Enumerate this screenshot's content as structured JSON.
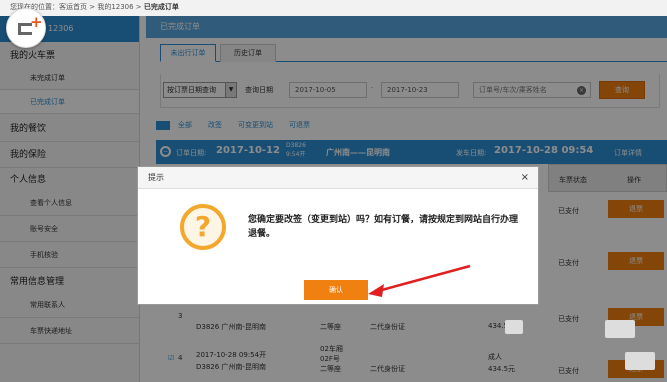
{
  "breadcrumb": {
    "prefix": "您现在的位置：客运首页 > 我的12306 >",
    "current": "已完成订单"
  },
  "sidebar": {
    "header": "12306",
    "sections": [
      {
        "title": "我的火车票",
        "items": [
          "未完成订单",
          "已完成订单"
        ]
      },
      {
        "title": "我的餐饮",
        "items": []
      },
      {
        "title": "我的保险",
        "items": []
      },
      {
        "title": "个人信息",
        "items": [
          "查看个人信息",
          "账号安全",
          "手机核验"
        ]
      },
      {
        "title": "常用信息管理",
        "items": [
          "常用联系人",
          "车票快递地址"
        ]
      }
    ]
  },
  "main": {
    "header": "已完成订单"
  },
  "tabs": [
    "未出行订单",
    "历史订单"
  ],
  "filter": {
    "select_value": "按订票日期查询",
    "date_label": "查询日期",
    "date_from": "2017-10-05",
    "date_to": "2017-10-23",
    "separator": "-",
    "keyword_placeholder": "订单号/车次/乘客姓名",
    "query_button": "查询"
  },
  "links": [
    "全部",
    "改签",
    "可变更到站",
    "可退票"
  ],
  "order": {
    "date_label": "订单日期:",
    "date": "2017-10-12",
    "route": "广州南——昆明南",
    "depart_label": "发车日期:",
    "depart": "2017-10-28 09:54",
    "detail": "订单详情",
    "sub1": "D3826",
    "sub2": "9:54开"
  },
  "table": {
    "col_status": "车票状态",
    "col_action": "操作",
    "rows": [
      {
        "status": "已支付",
        "action": "退票"
      },
      {
        "status": "已支付",
        "action": "退票"
      },
      {
        "status": "已支付",
        "action": "退票",
        "num": "3",
        "train": "D3826 广州南-昆明南",
        "seat": "二等座",
        "id_type": "二代身份证",
        "price": "434.5"
      },
      {
        "status": "已支付",
        "action": "退票",
        "num": "4",
        "time": "2017-10-28 09:54开",
        "train": "D3826 广州南-昆明南",
        "coach": "02车厢",
        "seat_no": "02F号",
        "seat": "二等座",
        "id_type": "二代身份证",
        "price_prefix": "成人",
        "price": "434.5元"
      }
    ]
  },
  "dialog": {
    "title": "提示",
    "close": "×",
    "icon": "?",
    "message": "您确定要改签（变更到站）吗？如有订餐，请按规定到网站自行办理退餐。",
    "ok": "确认"
  },
  "colors": {
    "primary": "#2f8fd3",
    "accent": "#f08010"
  }
}
